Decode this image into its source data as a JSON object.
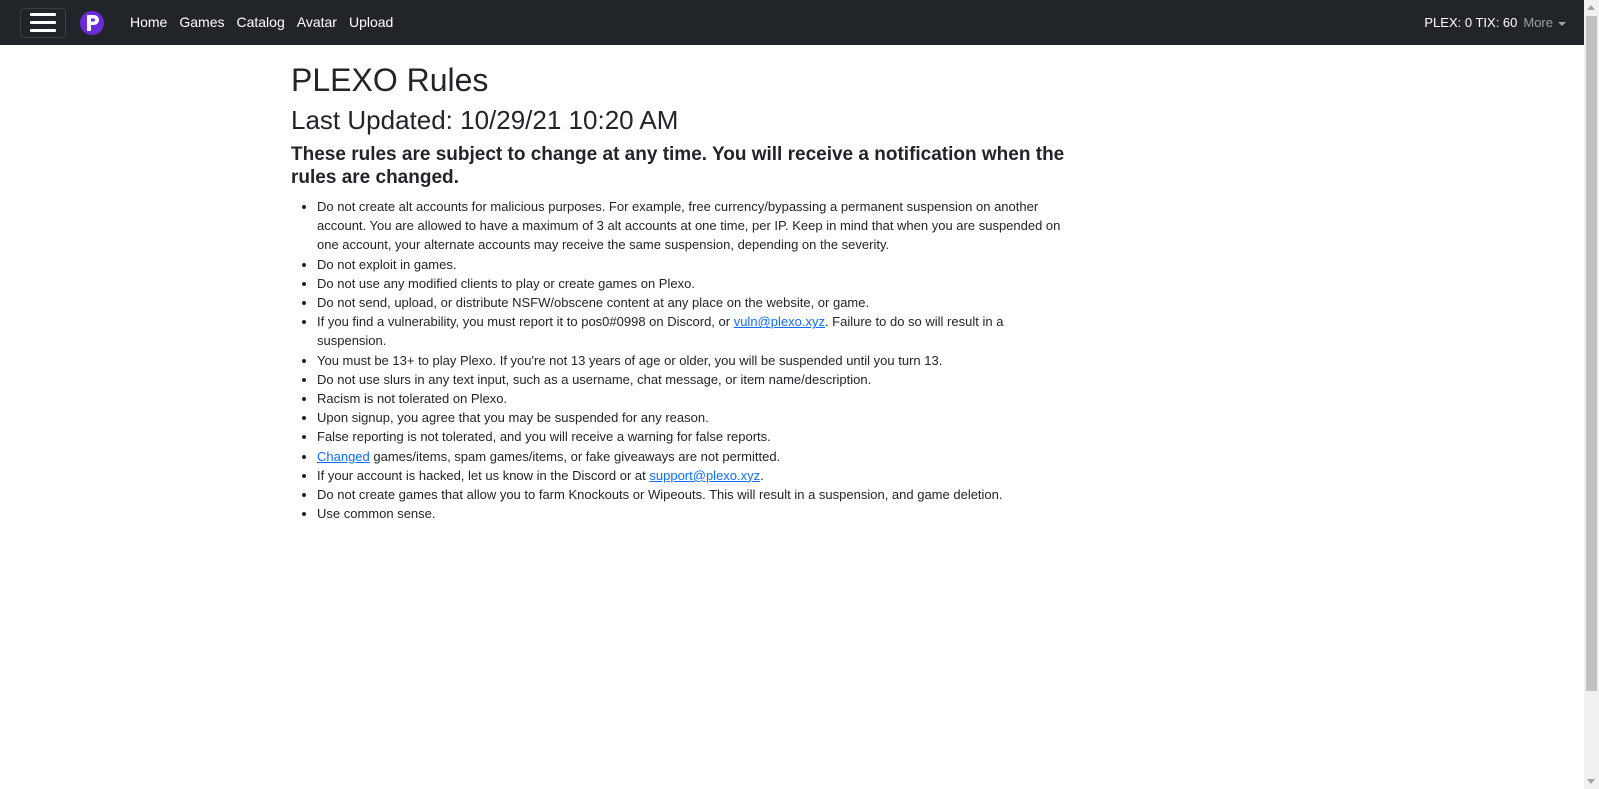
{
  "nav": {
    "links": [
      "Home",
      "Games",
      "Catalog",
      "Avatar",
      "Upload"
    ],
    "currency": "PLEX: 0 TIX: 60",
    "more": "More"
  },
  "page": {
    "title": "PLEXO Rules",
    "updated": "Last Updated: 10/29/21 10:20 AM",
    "notice": "These rules are subject to change at any time. You will receive a notification when the rules are changed."
  },
  "rules": [
    {
      "text": "Do not create alt accounts for malicious purposes. For example, free currency/bypassing a permanent suspension on another account. You are allowed to have a maximum of 3 alt accounts at one time, per IP. Keep in mind that when you are suspended on one account, your alternate accounts may receive the same suspension, depending on the severity."
    },
    {
      "text": "Do not exploit in games."
    },
    {
      "text": "Do not use any modified clients to play or create games on Plexo."
    },
    {
      "text": "Do not send, upload, or distribute NSFW/obscene content at any place on the website, or game."
    },
    {
      "before": "If you find a vulnerability, you must report it to pos0#0998 on Discord, or ",
      "link": "vuln@plexo.xyz",
      "after": ". Failure to do so will result in a suspension."
    },
    {
      "text": "You must be 13+ to play Plexo. If you're not 13 years of age or older, you will be suspended until you turn 13."
    },
    {
      "text": "Do not use slurs in any text input, such as a username, chat message, or item name/description."
    },
    {
      "text": "Racism is not tolerated on Plexo."
    },
    {
      "text": "Upon signup, you agree that you may be suspended for any reason."
    },
    {
      "text": "False reporting is not tolerated, and you will receive a warning for false reports."
    },
    {
      "before": "",
      "link": "Changed",
      "after": " games/items, spam games/items, or fake giveaways are not permitted."
    },
    {
      "before": "If your account is hacked, let us know in the Discord or at ",
      "link": "support@plexo.xyz",
      "after": "."
    },
    {
      "text": "Do not create games that allow you to farm Knockouts or Wipeouts. This will result in a suspension, and game deletion."
    },
    {
      "text": "Use common sense."
    }
  ]
}
